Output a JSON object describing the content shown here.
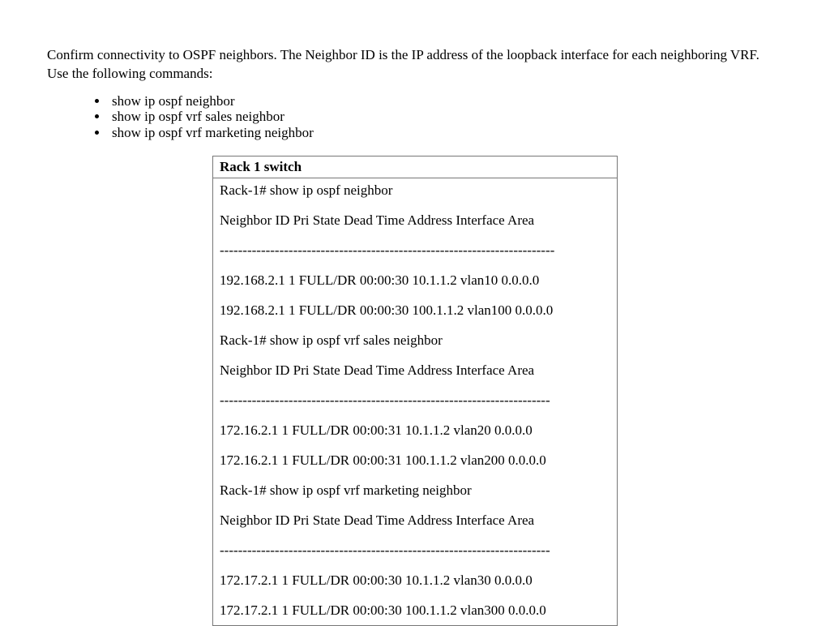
{
  "intro": "Confirm connectivity to OSPF neighbors. The Neighbor ID is the IP address of the loopback interface for each neighboring VRF. Use the following commands:",
  "commands": [
    "show ip ospf neighbor",
    "show ip ospf vrf sales neighbor",
    "show ip ospf vrf marketing neighbor"
  ],
  "box": {
    "title": "Rack 1 switch",
    "lines": [
      "Rack-1# show ip ospf neighbor",
      "Neighbor ID Pri State Dead Time Address Interface Area",
      "-------------------------------------------------------------------------",
      "192.168.2.1 1 FULL/DR 00:00:30 10.1.1.2 vlan10 0.0.0.0",
      "192.168.2.1 1 FULL/DR 00:00:30 100.1.1.2 vlan100 0.0.0.0",
      "Rack-1# show ip ospf vrf sales neighbor",
      "Neighbor ID Pri State Dead Time Address Interface Area",
      "------------------------------------------------------------------------",
      "172.16.2.1 1 FULL/DR 00:00:31 10.1.1.2 vlan20 0.0.0.0",
      "172.16.2.1 1 FULL/DR 00:00:31 100.1.1.2 vlan200 0.0.0.0",
      "Rack-1# show ip ospf vrf marketing neighbor",
      "Neighbor ID Pri State Dead Time Address Interface Area",
      "------------------------------------------------------------------------",
      "172.17.2.1 1 FULL/DR 00:00:30 10.1.1.2 vlan30 0.0.0.0",
      "172.17.2.1 1 FULL/DR 00:00:30 100.1.1.2 vlan300 0.0.0.0"
    ]
  }
}
